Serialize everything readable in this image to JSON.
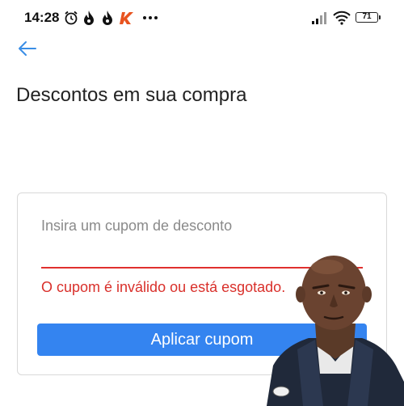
{
  "status_bar": {
    "time": "14:28",
    "battery": "71",
    "icons": [
      "alarm-icon",
      "flame-icon",
      "flame-icon",
      "app-k-icon",
      "more-dots-icon",
      "signal-icon",
      "wifi-icon",
      "battery-icon"
    ]
  },
  "page": {
    "title": "Descontos em sua compra"
  },
  "coupon": {
    "input_value": "",
    "placeholder": "Insira um cupom de desconto",
    "error": "O cupom é inválido ou está esgotado.",
    "apply_label": "Aplicar cupom"
  },
  "colors": {
    "accent": "#3484f0",
    "error": "#d9302b",
    "back_arrow": "#3a8ee6"
  }
}
